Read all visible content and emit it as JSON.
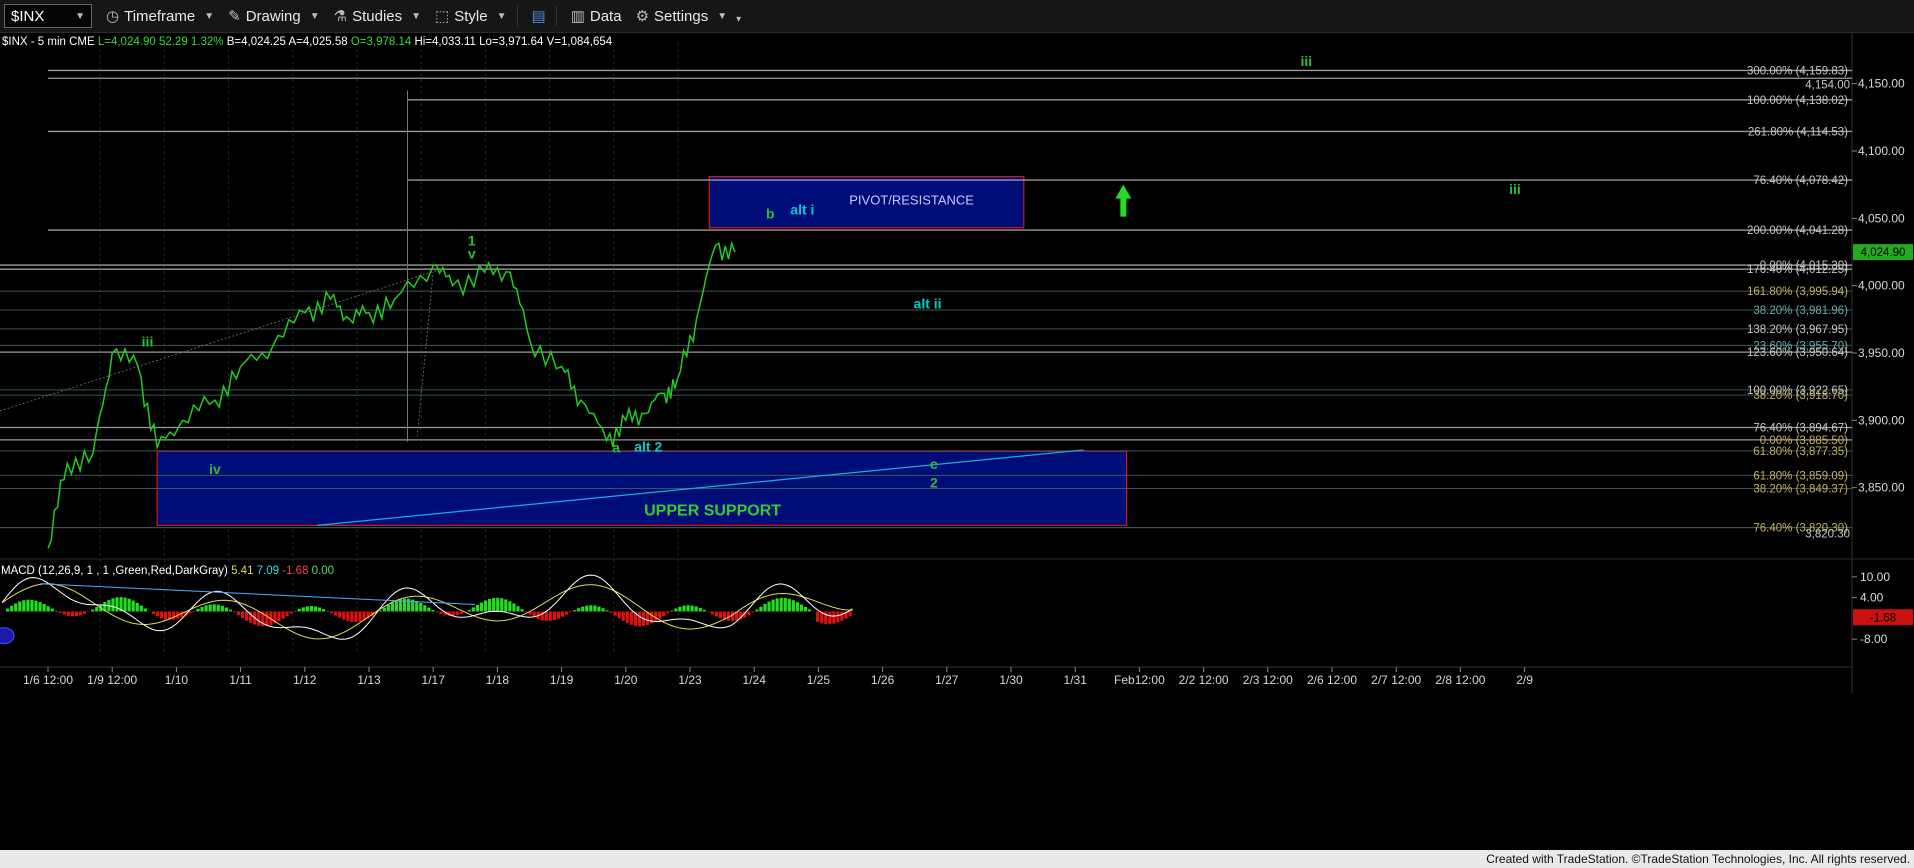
{
  "toolbar": {
    "symbol": "$INX",
    "timeframe_label": "Timeframe",
    "drawing_label": "Drawing",
    "studies_label": "Studies",
    "style_label": "Style",
    "data_label": "Data",
    "settings_label": "Settings"
  },
  "header": {
    "symbol": "$INX - 5 min",
    "exchange": "CME",
    "last": "L=4,024.90",
    "change": "52.29",
    "change_pct": "1.32%",
    "bid": "B=4,024.25",
    "ask": "A=4,025.58",
    "open": "O=3,978.14",
    "high": "Hi=4,033.11",
    "low": "Lo=3,971.64",
    "volume": "V=1,084,654"
  },
  "macd_header": {
    "label": "MACD (12,26,9, 1 , 1 ,Green,Red,DarkGray)",
    "v1": "5.41",
    "v2": "7.09",
    "v3": "-1.68",
    "v4": "0.00"
  },
  "footer": "Created with TradeStation. ©TradeStation Technologies, Inc. All rights reserved.",
  "colors": {
    "price": "#22cc22",
    "wave_green": "#33bb33",
    "wave_cyan": "#00cccc",
    "zone_fill": "#000c78",
    "zone_border": "#c81e1e",
    "macd_pos": "#22dd22",
    "macd_neg": "#dd1111",
    "signal": "#dddd55",
    "macd_line": "#ffffff",
    "fib_text": "#c8c8c8",
    "fib_gold": "#c8b060",
    "fib_teal": "#66aaaa"
  },
  "chart_data": {
    "type": "line",
    "title": "$INX - 5 min",
    "x": [
      "1/6 12:00",
      "1/9 12:00",
      "1/10",
      "1/11",
      "1/12",
      "1/13",
      "1/17",
      "1/18",
      "1/19",
      "1/20",
      "1/23",
      "1/24",
      "1/25",
      "1/26",
      "1/27",
      "1/30",
      "1/31",
      "Feb12:00",
      "2/2 12:00",
      "2/3 12:00",
      "2/6 12:00",
      "2/7 12:00",
      "2/8 12:00",
      "2/9"
    ],
    "ylim": [
      3800,
      4175
    ],
    "y_ticks": [
      "3,850.00",
      "3,900.00",
      "3,950.00",
      "4,000.00",
      "4,050.00",
      "4,100.00",
      "4,150.00"
    ],
    "last_price_label": "4,024.90",
    "series": [
      {
        "points": [
          [
            0,
            3805
          ],
          [
            0.3,
            3868
          ],
          [
            0.7,
            3875
          ],
          [
            1.0,
            3950
          ],
          [
            1.4,
            3940
          ],
          [
            1.7,
            3880
          ],
          [
            2.1,
            3900
          ],
          [
            2.6,
            3915
          ],
          [
            3.0,
            3940
          ],
          [
            3.5,
            3955
          ],
          [
            4.0,
            3980
          ],
          [
            4.4,
            3990
          ],
          [
            4.7,
            3975
          ],
          [
            5.0,
            3980
          ],
          [
            5.4,
            3990
          ],
          [
            6.0,
            4015
          ],
          [
            6.3,
            4000
          ],
          [
            6.8,
            4010
          ],
          [
            7.2,
            4010
          ],
          [
            7.5,
            3960
          ],
          [
            8.0,
            3940
          ],
          [
            8.3,
            3915
          ],
          [
            8.7,
            3885
          ],
          [
            9.0,
            3900
          ],
          [
            9.3,
            3905
          ],
          [
            9.6,
            3920
          ],
          [
            9.8,
            3930
          ],
          [
            10.1,
            3975
          ],
          [
            10.4,
            4030
          ],
          [
            10.7,
            4025
          ]
        ]
      }
    ],
    "fib_levels": [
      {
        "label": "300.00% (4,159.83)",
        "value": 4159.83
      },
      {
        "label": "4,154.00",
        "value": 4154.0
      },
      {
        "label": "100.00% (4,138.02)",
        "value": 4138.02
      },
      {
        "label": "261.80% (4,114.53)",
        "value": 4114.53
      },
      {
        "label": "76.40% (4,078.42)",
        "value": 4078.42
      },
      {
        "label": "200.00% (4,041.28)",
        "value": 4041.28
      },
      {
        "label": "0.00% (4,015.30)",
        "value": 4015.3
      },
      {
        "label": "176.40% (4,012.25)",
        "value": 4012.25
      },
      {
        "label": "161.80% (3,995.94)",
        "value": 3995.94
      },
      {
        "label": "38.20% (3,981.96)",
        "value": 3981.96
      },
      {
        "label": "138.20% (3,967.95)",
        "value": 3967.95
      },
      {
        "label": "23.60% (3,955.70)",
        "value": 3955.7
      },
      {
        "label": "123.60% (3,950.64)",
        "value": 3950.64
      },
      {
        "label": "100.00% (3,922.65)",
        "value": 3922.65
      },
      {
        "label": "38.20% (3,918.70)",
        "value": 3918.7
      },
      {
        "label": "76.40% (3,894.67)",
        "value": 3894.67
      },
      {
        "label": "0.00% (3,885.50)",
        "value": 3885.5
      },
      {
        "label": "61.80% (3,877.35)",
        "value": 3877.35
      },
      {
        "label": "61.80% (3,859.09)",
        "value": 3859.09
      },
      {
        "label": "38.20% (3,849.37)",
        "value": 3849.37
      },
      {
        "label": "76.40% (3,820.30)",
        "value": 3820.3
      },
      {
        "label": "3,820.30",
        "value": 3820.3
      }
    ],
    "zones": [
      {
        "label": "PIVOT/RESISTANCE",
        "x0": 10.3,
        "x1": 15.2,
        "y0": 4043,
        "y1": 4081
      },
      {
        "label": "UPPER SUPPORT",
        "x0": 1.7,
        "x1": 16.8,
        "y0": 3822,
        "y1": 3877
      }
    ],
    "wave_labels": [
      {
        "text": "iii",
        "x": 1.55,
        "y": 3955,
        "color": "green"
      },
      {
        "text": "iv",
        "x": 2.6,
        "y": 3860,
        "color": "green"
      },
      {
        "text": "1",
        "x": 6.6,
        "y": 4030,
        "color": "green"
      },
      {
        "text": "v",
        "x": 6.6,
        "y": 4020,
        "color": "green"
      },
      {
        "text": "b",
        "x": 11.25,
        "y": 4050,
        "color": "green"
      },
      {
        "text": "alt i",
        "x": 11.75,
        "y": 4053,
        "color": "cyan"
      },
      {
        "text": "a",
        "x": 8.85,
        "y": 3876,
        "color": "green"
      },
      {
        "text": "alt 2",
        "x": 9.35,
        "y": 3877,
        "color": "cyan"
      },
      {
        "text": "alt ii",
        "x": 13.7,
        "y": 3983,
        "color": "cyan"
      },
      {
        "text": "c",
        "x": 13.8,
        "y": 3864,
        "color": "green"
      },
      {
        "text": "2",
        "x": 13.8,
        "y": 3850,
        "color": "green"
      },
      {
        "text": "iii",
        "x": 19.6,
        "y": 4163,
        "color": "green"
      },
      {
        "text": "iii",
        "x": 22.85,
        "y": 4068,
        "color": "green"
      }
    ],
    "macd": {
      "ylim": [
        -12,
        14
      ],
      "y_ticks": [
        "10.00",
        "4.00",
        "-8.00"
      ],
      "last_label": "-1.68"
    }
  }
}
